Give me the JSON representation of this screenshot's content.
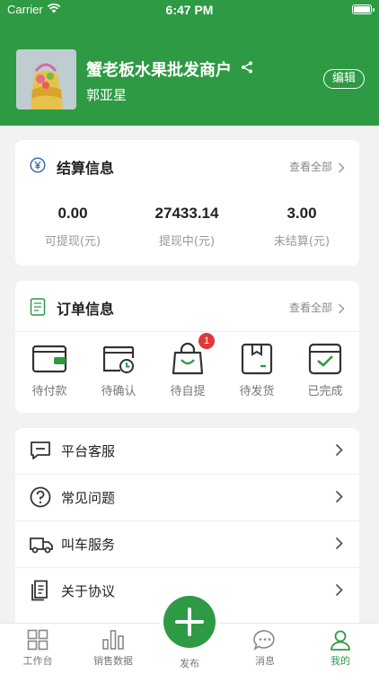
{
  "status_bar": {
    "carrier": "Carrier",
    "time": "6:47 PM"
  },
  "profile": {
    "shop_name": "蟹老板水果批发商户",
    "owner_name": "郭亚星",
    "edit_label": "编辑"
  },
  "settlement": {
    "title": "结算信息",
    "view_all": "查看全部",
    "stats": [
      {
        "value": "0.00",
        "label": "可提现(元)"
      },
      {
        "value": "27433.14",
        "label": "提现中(元)"
      },
      {
        "value": "3.00",
        "label": "未结算(元)"
      }
    ]
  },
  "orders": {
    "title": "订单信息",
    "view_all": "查看全部",
    "items": [
      {
        "label": "待付款",
        "icon": "wallet-icon"
      },
      {
        "label": "待确认",
        "icon": "calendar-clock-icon"
      },
      {
        "label": "待自提",
        "icon": "shopping-bag-icon",
        "badge": "1"
      },
      {
        "label": "待发货",
        "icon": "package-icon"
      },
      {
        "label": "已完成",
        "icon": "check-calendar-icon"
      }
    ]
  },
  "menu": [
    {
      "label": "平台客服",
      "icon": "chat-icon"
    },
    {
      "label": "常见问题",
      "icon": "question-icon"
    },
    {
      "label": "叫车服务",
      "icon": "truck-icon"
    },
    {
      "label": "关于协议",
      "icon": "document-icon"
    }
  ],
  "tabbar": {
    "items": [
      {
        "label": "工作台",
        "icon": "grid-icon"
      },
      {
        "label": "销售数据",
        "icon": "bar-chart-icon"
      },
      {
        "label": "发布",
        "icon": "plus-icon"
      },
      {
        "label": "消息",
        "icon": "message-icon"
      },
      {
        "label": "我的",
        "icon": "user-icon",
        "active": true
      }
    ]
  },
  "colors": {
    "brand": "#2e9a44",
    "badge": "#e0373a",
    "background": "#f2f2f2"
  }
}
